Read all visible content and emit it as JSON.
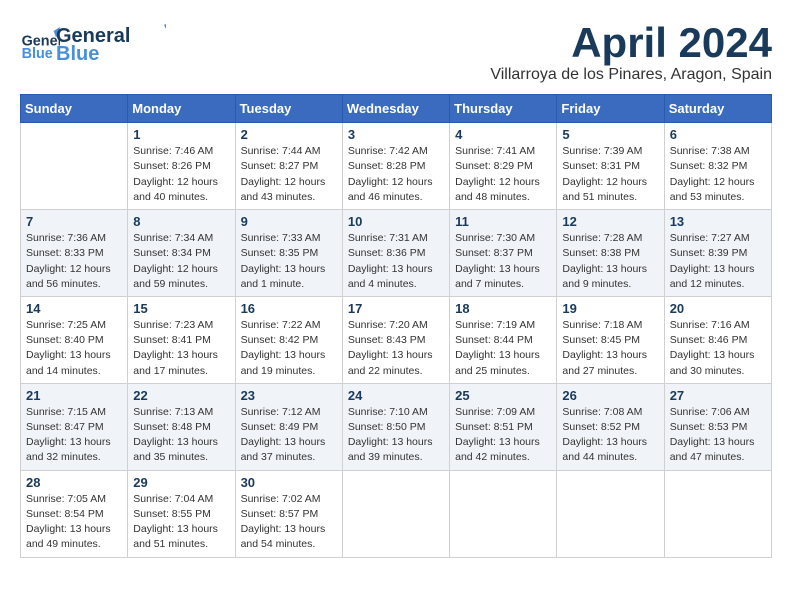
{
  "header": {
    "logo_general": "General",
    "logo_blue": "Blue",
    "month": "April 2024",
    "location": "Villarroya de los Pinares, Aragon, Spain"
  },
  "days_of_week": [
    "Sunday",
    "Monday",
    "Tuesday",
    "Wednesday",
    "Thursday",
    "Friday",
    "Saturday"
  ],
  "weeks": [
    [
      {
        "day": "",
        "info": ""
      },
      {
        "day": "1",
        "info": "Sunrise: 7:46 AM\nSunset: 8:26 PM\nDaylight: 12 hours\nand 40 minutes."
      },
      {
        "day": "2",
        "info": "Sunrise: 7:44 AM\nSunset: 8:27 PM\nDaylight: 12 hours\nand 43 minutes."
      },
      {
        "day": "3",
        "info": "Sunrise: 7:42 AM\nSunset: 8:28 PM\nDaylight: 12 hours\nand 46 minutes."
      },
      {
        "day": "4",
        "info": "Sunrise: 7:41 AM\nSunset: 8:29 PM\nDaylight: 12 hours\nand 48 minutes."
      },
      {
        "day": "5",
        "info": "Sunrise: 7:39 AM\nSunset: 8:31 PM\nDaylight: 12 hours\nand 51 minutes."
      },
      {
        "day": "6",
        "info": "Sunrise: 7:38 AM\nSunset: 8:32 PM\nDaylight: 12 hours\nand 53 minutes."
      }
    ],
    [
      {
        "day": "7",
        "info": "Sunrise: 7:36 AM\nSunset: 8:33 PM\nDaylight: 12 hours\nand 56 minutes."
      },
      {
        "day": "8",
        "info": "Sunrise: 7:34 AM\nSunset: 8:34 PM\nDaylight: 12 hours\nand 59 minutes."
      },
      {
        "day": "9",
        "info": "Sunrise: 7:33 AM\nSunset: 8:35 PM\nDaylight: 13 hours\nand 1 minute."
      },
      {
        "day": "10",
        "info": "Sunrise: 7:31 AM\nSunset: 8:36 PM\nDaylight: 13 hours\nand 4 minutes."
      },
      {
        "day": "11",
        "info": "Sunrise: 7:30 AM\nSunset: 8:37 PM\nDaylight: 13 hours\nand 7 minutes."
      },
      {
        "day": "12",
        "info": "Sunrise: 7:28 AM\nSunset: 8:38 PM\nDaylight: 13 hours\nand 9 minutes."
      },
      {
        "day": "13",
        "info": "Sunrise: 7:27 AM\nSunset: 8:39 PM\nDaylight: 13 hours\nand 12 minutes."
      }
    ],
    [
      {
        "day": "14",
        "info": "Sunrise: 7:25 AM\nSunset: 8:40 PM\nDaylight: 13 hours\nand 14 minutes."
      },
      {
        "day": "15",
        "info": "Sunrise: 7:23 AM\nSunset: 8:41 PM\nDaylight: 13 hours\nand 17 minutes."
      },
      {
        "day": "16",
        "info": "Sunrise: 7:22 AM\nSunset: 8:42 PM\nDaylight: 13 hours\nand 19 minutes."
      },
      {
        "day": "17",
        "info": "Sunrise: 7:20 AM\nSunset: 8:43 PM\nDaylight: 13 hours\nand 22 minutes."
      },
      {
        "day": "18",
        "info": "Sunrise: 7:19 AM\nSunset: 8:44 PM\nDaylight: 13 hours\nand 25 minutes."
      },
      {
        "day": "19",
        "info": "Sunrise: 7:18 AM\nSunset: 8:45 PM\nDaylight: 13 hours\nand 27 minutes."
      },
      {
        "day": "20",
        "info": "Sunrise: 7:16 AM\nSunset: 8:46 PM\nDaylight: 13 hours\nand 30 minutes."
      }
    ],
    [
      {
        "day": "21",
        "info": "Sunrise: 7:15 AM\nSunset: 8:47 PM\nDaylight: 13 hours\nand 32 minutes."
      },
      {
        "day": "22",
        "info": "Sunrise: 7:13 AM\nSunset: 8:48 PM\nDaylight: 13 hours\nand 35 minutes."
      },
      {
        "day": "23",
        "info": "Sunrise: 7:12 AM\nSunset: 8:49 PM\nDaylight: 13 hours\nand 37 minutes."
      },
      {
        "day": "24",
        "info": "Sunrise: 7:10 AM\nSunset: 8:50 PM\nDaylight: 13 hours\nand 39 minutes."
      },
      {
        "day": "25",
        "info": "Sunrise: 7:09 AM\nSunset: 8:51 PM\nDaylight: 13 hours\nand 42 minutes."
      },
      {
        "day": "26",
        "info": "Sunrise: 7:08 AM\nSunset: 8:52 PM\nDaylight: 13 hours\nand 44 minutes."
      },
      {
        "day": "27",
        "info": "Sunrise: 7:06 AM\nSunset: 8:53 PM\nDaylight: 13 hours\nand 47 minutes."
      }
    ],
    [
      {
        "day": "28",
        "info": "Sunrise: 7:05 AM\nSunset: 8:54 PM\nDaylight: 13 hours\nand 49 minutes."
      },
      {
        "day": "29",
        "info": "Sunrise: 7:04 AM\nSunset: 8:55 PM\nDaylight: 13 hours\nand 51 minutes."
      },
      {
        "day": "30",
        "info": "Sunrise: 7:02 AM\nSunset: 8:57 PM\nDaylight: 13 hours\nand 54 minutes."
      },
      {
        "day": "",
        "info": ""
      },
      {
        "day": "",
        "info": ""
      },
      {
        "day": "",
        "info": ""
      },
      {
        "day": "",
        "info": ""
      }
    ]
  ]
}
